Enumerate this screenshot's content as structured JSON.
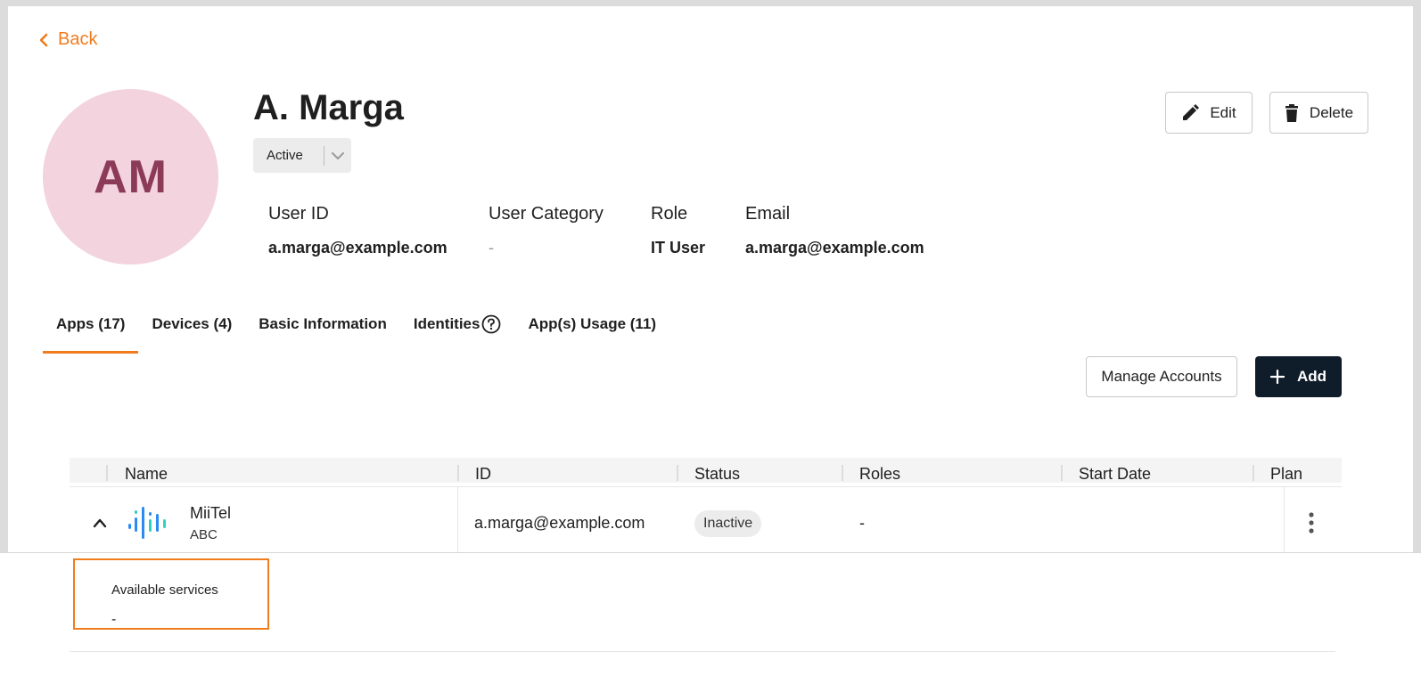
{
  "nav": {
    "back_label": "Back"
  },
  "profile": {
    "initials": "AM",
    "name": "A. Marga",
    "status": "Active",
    "fields": {
      "user_id_label": "User ID",
      "user_id_value": "a.marga@example.com",
      "category_label": "User Category",
      "category_value": "-",
      "role_label": "Role",
      "role_value": "IT User",
      "email_label": "Email",
      "email_value": "a.marga@example.com"
    }
  },
  "actions": {
    "edit_label": "Edit",
    "delete_label": "Delete",
    "manage_label": "Manage Accounts",
    "add_label": "Add"
  },
  "tabs": [
    {
      "label": "Apps (17)",
      "active": true
    },
    {
      "label": "Devices (4)"
    },
    {
      "label": "Basic Information"
    },
    {
      "label": "Identities"
    },
    {
      "label": "App(s) Usage (11)"
    }
  ],
  "table": {
    "columns": [
      "Name",
      "ID",
      "Status",
      "Roles",
      "Start Date",
      "Plan"
    ],
    "rows": [
      {
        "name": "MiiTel",
        "org": "ABC",
        "id": "a.marga@example.com",
        "status": "Inactive",
        "roles": "-",
        "start_date": "",
        "plan": ""
      }
    ]
  },
  "expanded": {
    "services_label": "Available services",
    "services_value": "-"
  },
  "colors": {
    "accent": "#f07c1e",
    "dark_button": "#0f1c2a",
    "avatar_bg": "#f3d3de",
    "avatar_text": "#8b3a58"
  },
  "icons": [
    "chevron-left-icon",
    "chevron-down-icon",
    "pencil-icon",
    "trash-icon",
    "help-circle-icon",
    "plus-icon",
    "chevron-up-icon",
    "miitel-logo-icon",
    "more-vertical-icon"
  ]
}
